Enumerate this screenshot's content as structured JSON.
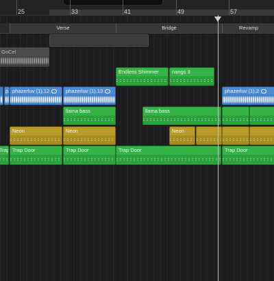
{
  "ruler": {
    "bars": [
      "25",
      "33",
      "41",
      "49",
      "57"
    ]
  },
  "arrangement": {
    "markers": [
      "Verse",
      "Bridge",
      "Revamp"
    ]
  },
  "tracks": {
    "gray": {
      "label": "GoCel"
    },
    "green_top": [
      {
        "label": "Endless Shimmer"
      },
      {
        "label": "nangs 3"
      }
    ],
    "blue": [
      {
        "label": "p"
      },
      {
        "label": "phazerluv (1).12"
      },
      {
        "label": "phazerluv (1).13"
      },
      {
        "label": "phazerluv (1).2"
      }
    ],
    "llama": [
      {
        "label": "llama bass"
      },
      {
        "label": "llama bass"
      }
    ],
    "neon": [
      {
        "label": "Neon"
      },
      {
        "label": "Neon"
      },
      {
        "label": "Neon"
      }
    ],
    "trap": [
      {
        "label": "Trap"
      },
      {
        "label": "Trap Door"
      },
      {
        "label": "Trap Door"
      },
      {
        "label": "Trap Door"
      },
      {
        "label": "Trap Door"
      }
    ]
  },
  "colors": {
    "green": "#2ca03a",
    "blue": "#3f7cc4",
    "yellow": "#a78e22",
    "background": "#1c1c1e"
  }
}
